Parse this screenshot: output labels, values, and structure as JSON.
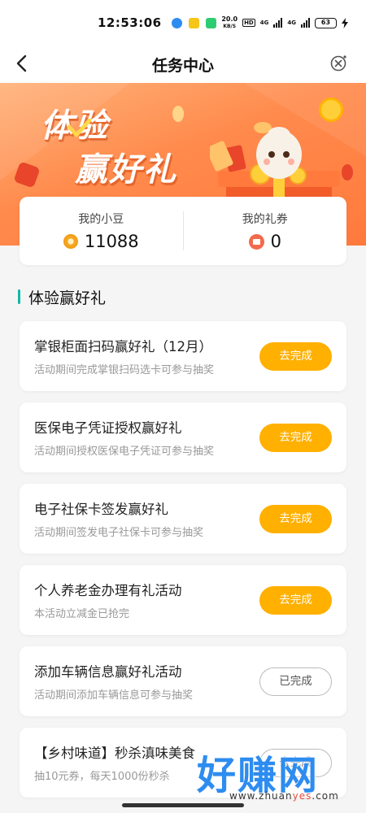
{
  "status_bar": {
    "time": "12:53:06",
    "net_speed_value": "20.0",
    "net_speed_unit": "KB/S",
    "hd": "HD",
    "network_1": "4G",
    "network_2": "4G",
    "battery": "63"
  },
  "nav": {
    "title": "任务中心"
  },
  "banner": {
    "line1": "体验",
    "line2": "赢好礼"
  },
  "stats": {
    "beans_label": "我的小豆",
    "beans_value": "11088",
    "coupons_label": "我的礼券",
    "coupons_value": "0"
  },
  "section": {
    "title": "体验赢好礼"
  },
  "tasks": [
    {
      "title": "掌银柜面扫码赢好礼（12月）",
      "subtitle": "活动期间完成掌银扫码选卡可参与抽奖",
      "button": "去完成",
      "status": "pending"
    },
    {
      "title": "医保电子凭证授权赢好礼",
      "subtitle": "活动期间授权医保电子凭证可参与抽奖",
      "button": "去完成",
      "status": "pending"
    },
    {
      "title": "电子社保卡签发赢好礼",
      "subtitle": "活动期间签发电子社保卡可参与抽奖",
      "button": "去完成",
      "status": "pending"
    },
    {
      "title": "个人养老金办理有礼活动",
      "subtitle": "本活动立减金已抢完",
      "button": "去完成",
      "status": "pending"
    },
    {
      "title": "添加车辆信息赢好礼活动",
      "subtitle": "活动期间添加车辆信息可参与抽奖",
      "button": "已完成",
      "status": "done"
    },
    {
      "title": "【乡村味道】秒杀滇味美食",
      "subtitle": "抽10元券，每天1000份秒杀",
      "button": "去完成",
      "status": "pending"
    }
  ],
  "watermark": {
    "main": "好赚网",
    "url_prefix": "www.zhuan",
    "url_highlight": "yes",
    "url_suffix": ".com"
  },
  "colors": {
    "accent_button": "#ffb000",
    "banner_orange": "#ff8a4c",
    "section_bar": "#14b8a6"
  }
}
